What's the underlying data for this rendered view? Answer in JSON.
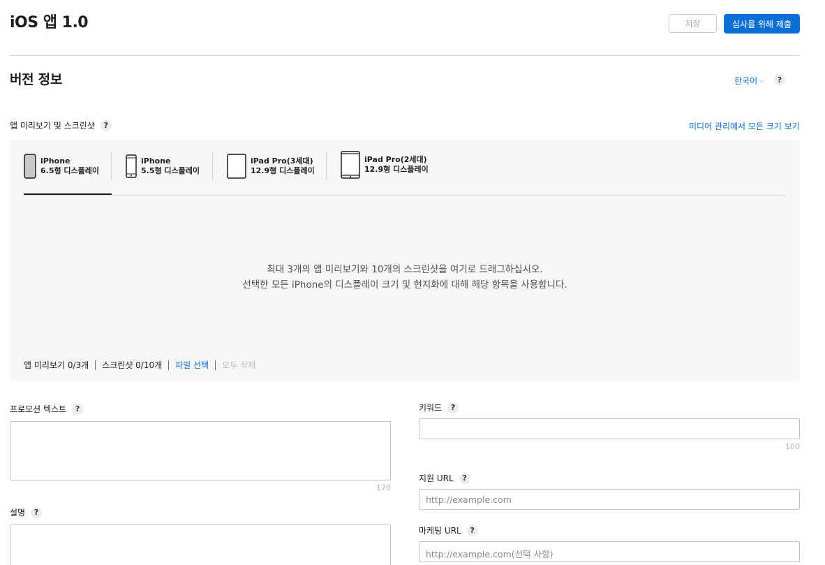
{
  "header": {
    "title": "iOS 앱 1.0",
    "save_label": "저장",
    "submit_label": "심사를 위해 제출"
  },
  "version_info": {
    "title": "버전 정보",
    "language": "한국어",
    "help": "?"
  },
  "preview": {
    "label": "앱 미리보기 및 스크린샷",
    "help": "?",
    "media_link": "미디어 관리에서 모든 크기 보기",
    "tabs": [
      {
        "name": "iPhone",
        "display": "6.5형 디스플레이"
      },
      {
        "name": "iPhone",
        "display": "5.5형 디스플레이"
      },
      {
        "name": "iPad Pro(3세대)",
        "display": "12.9형 디스플레이"
      },
      {
        "name": "iPad Pro(2세대)",
        "display": "12.9형 디스플레이"
      }
    ],
    "drop_line1": "최대 3개의 앱 미리보기와 10개의 스크린샷을 여기로 드래그하십시오.",
    "drop_line2": "선택한 모든 iPhone의 디스플레이 크기 및 현지화에 대해 해당 항목을 사용합니다.",
    "preview_count": "앱 미리보기 0/3개",
    "screenshot_count": "스크린샷 0/10개",
    "choose_file": "파일 선택",
    "delete_all": "모두 삭제"
  },
  "form": {
    "promo_label": "프로모션 텍스트",
    "promo_counter": "170",
    "description_label": "설명",
    "keyword_label": "키워드",
    "keyword_counter": "100",
    "support_label": "지원 URL",
    "support_placeholder": "http://example.com",
    "marketing_label": "마케팅 URL",
    "marketing_placeholder": "http://example.com(선택 사항)",
    "help": "?"
  },
  "colors": {
    "accent": "#0a6fd6",
    "panel_bg": "#f7f7f7"
  }
}
